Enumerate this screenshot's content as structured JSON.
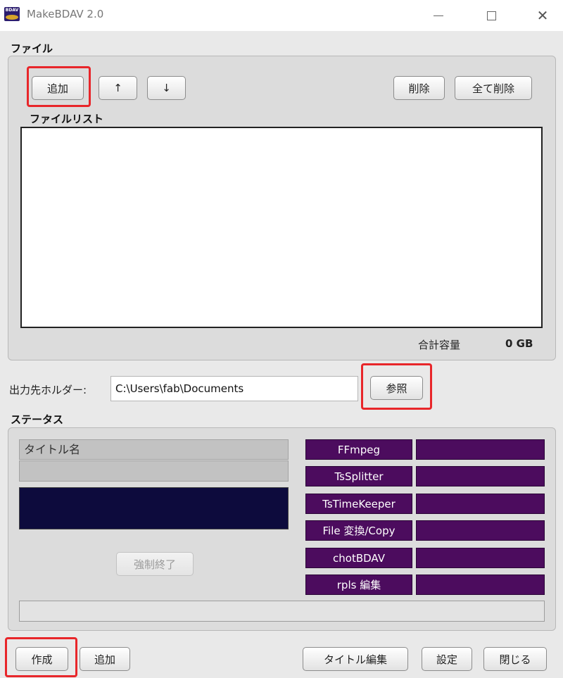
{
  "window": {
    "title": "MakeBDAV 2.0",
    "logo_text": "BDAV"
  },
  "file_section": {
    "label": "ファイル",
    "add_button": "追加",
    "up_button": "↑",
    "down_button": "↓",
    "delete_button": "削除",
    "delete_all_button": "全て削除",
    "list_label": "ファイルリスト",
    "files": [],
    "total_label": "合計容量",
    "total_value": "0 GB"
  },
  "output": {
    "label": "出力先ホルダー:",
    "path": "C:\\Users\\fab\\Documents",
    "browse_button": "参照"
  },
  "status_section": {
    "label": "ステータス",
    "title_column": "タイトル名",
    "force_stop_button": "強制終了",
    "tools": [
      {
        "label": "FFmpeg",
        "value": ""
      },
      {
        "label": "TsSplitter",
        "value": ""
      },
      {
        "label": "TsTimeKeeper",
        "value": ""
      },
      {
        "label": "File 変換/Copy",
        "value": ""
      },
      {
        "label": "chotBDAV",
        "value": ""
      },
      {
        "label": "rpls 編集",
        "value": ""
      }
    ]
  },
  "footer": {
    "create_button": "作成",
    "add_button": "追加",
    "edit_title_button": "タイトル編集",
    "settings_button": "設定",
    "close_button": "閉じる"
  },
  "colors": {
    "highlight": "#e8262a",
    "status_cell": "#4c0c5e",
    "dark_panel": "#0d0b3d"
  }
}
